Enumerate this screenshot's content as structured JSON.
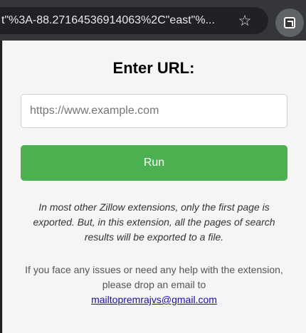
{
  "browser": {
    "url_fragment": "t\"%3A-88.27164536914063%2C\"east\"%...",
    "bookmark_icon": "star-icon",
    "extension_icon": "extension-icon"
  },
  "popup": {
    "title": "Enter URL:",
    "input_placeholder": "https://www.example.com",
    "input_value": "",
    "run_label": "Run",
    "info_text": "In most other Zillow extensions, only the first page is exported. But, in this extension, all the pages of search results will be exported to a file.",
    "help_text": "If you face any issues or need any help with the extension, please drop an email to",
    "email_link": "mailtopremrajvs@gmail.com"
  },
  "colors": {
    "run_button": "#4caf50",
    "link": "#1a0dab",
    "browser_bar": "#35363a"
  }
}
